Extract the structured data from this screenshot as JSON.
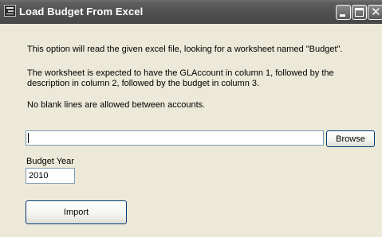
{
  "window": {
    "title": "Load Budget From Excel",
    "icon": "excel-app-icon",
    "controls": {
      "minimize": "minimize-icon",
      "maximize": "maximize-icon",
      "close": "close-icon"
    }
  },
  "content": {
    "info_line_1": "This option will read the given excel file, looking for a worksheet named \"Budget\".",
    "info_line_2": "The worksheet is expected to have the GLAccount in column 1, followed by the",
    "info_line_3": "description in column 2, followed by the budget in column 3.",
    "info_line_4": "No blank lines are allowed between accounts."
  },
  "file": {
    "value": "",
    "browse_label": "Browse"
  },
  "budget_year": {
    "label": "Budget Year",
    "value": "2010"
  },
  "actions": {
    "import_label": "Import"
  },
  "colors": {
    "titlebar": "#505050",
    "background": "#ece9d8",
    "button_border": "#003c74"
  }
}
